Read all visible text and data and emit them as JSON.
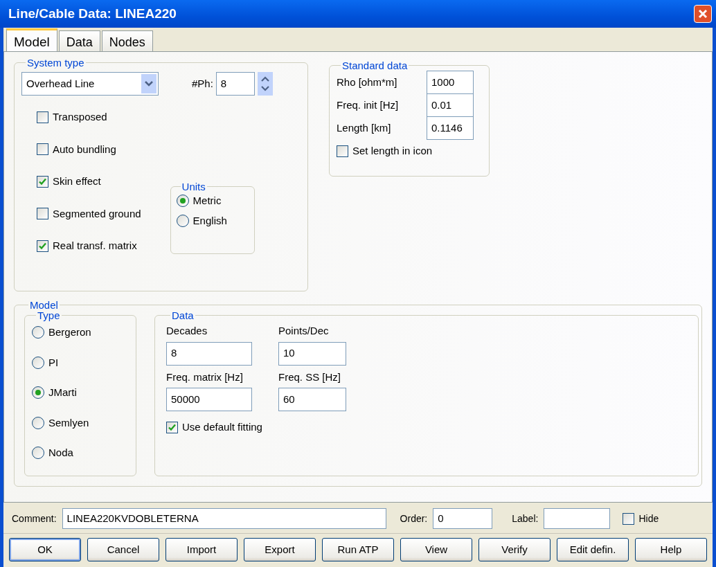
{
  "window": {
    "title": "Line/Cable Data: LINEA220"
  },
  "tabs": [
    {
      "label": "Model",
      "selected": true
    },
    {
      "label": "Data",
      "selected": false
    },
    {
      "label": "Nodes",
      "selected": false
    }
  ],
  "system_type": {
    "title": "System type",
    "line_type": "Overhead Line",
    "phases_label": "#Ph:",
    "phases": "8",
    "options": [
      {
        "label": "Transposed",
        "checked": false
      },
      {
        "label": "Auto bundling",
        "checked": false
      },
      {
        "label": "Skin effect",
        "checked": true
      },
      {
        "label": "Segmented ground",
        "checked": false
      },
      {
        "label": "Real transf. matrix",
        "checked": true
      }
    ],
    "units": {
      "title": "Units",
      "options": [
        {
          "label": "Metric",
          "selected": true
        },
        {
          "label": "English",
          "selected": false
        }
      ]
    }
  },
  "standard_data": {
    "title": "Standard data",
    "fields": [
      {
        "label": "Rho [ohm*m]",
        "value": "1000"
      },
      {
        "label": "Freq. init [Hz]",
        "value": "0.01"
      },
      {
        "label": "Length [km]",
        "value": "0.1146"
      }
    ],
    "set_length": {
      "label": "Set length in icon",
      "checked": false
    }
  },
  "model": {
    "title": "Model",
    "type": {
      "title": "Type",
      "options": [
        {
          "label": "Bergeron",
          "selected": false
        },
        {
          "label": "PI",
          "selected": false
        },
        {
          "label": "JMarti",
          "selected": true
        },
        {
          "label": "Semlyen",
          "selected": false
        },
        {
          "label": "Noda",
          "selected": false
        }
      ]
    },
    "data": {
      "title": "Data",
      "fields": [
        {
          "label": "Decades",
          "value": "8"
        },
        {
          "label": "Points/Dec",
          "value": "10"
        },
        {
          "label": "Freq. matrix [Hz]",
          "value": "50000"
        },
        {
          "label": "Freq. SS [Hz]",
          "value": "60"
        }
      ],
      "default_fitting": {
        "label": "Use default fitting",
        "checked": true
      }
    }
  },
  "footer": {
    "comment_label": "Comment:",
    "comment": "LINEA220KVDOBLETERNA",
    "order_label": "Order:",
    "order": "0",
    "label_label": "Label:",
    "hide": {
      "label": "Hide",
      "checked": false
    }
  },
  "buttons": [
    {
      "label": "OK",
      "focused": true
    },
    {
      "label": "Cancel",
      "focused": false
    },
    {
      "label": "Import",
      "focused": false
    },
    {
      "label": "Export",
      "focused": false
    },
    {
      "label": "Run ATP",
      "focused": false
    },
    {
      "label": "View",
      "focused": false
    },
    {
      "label": "Verify",
      "focused": false
    },
    {
      "label": "Edit defin.",
      "focused": false
    },
    {
      "label": "Help",
      "focused": false
    }
  ]
}
